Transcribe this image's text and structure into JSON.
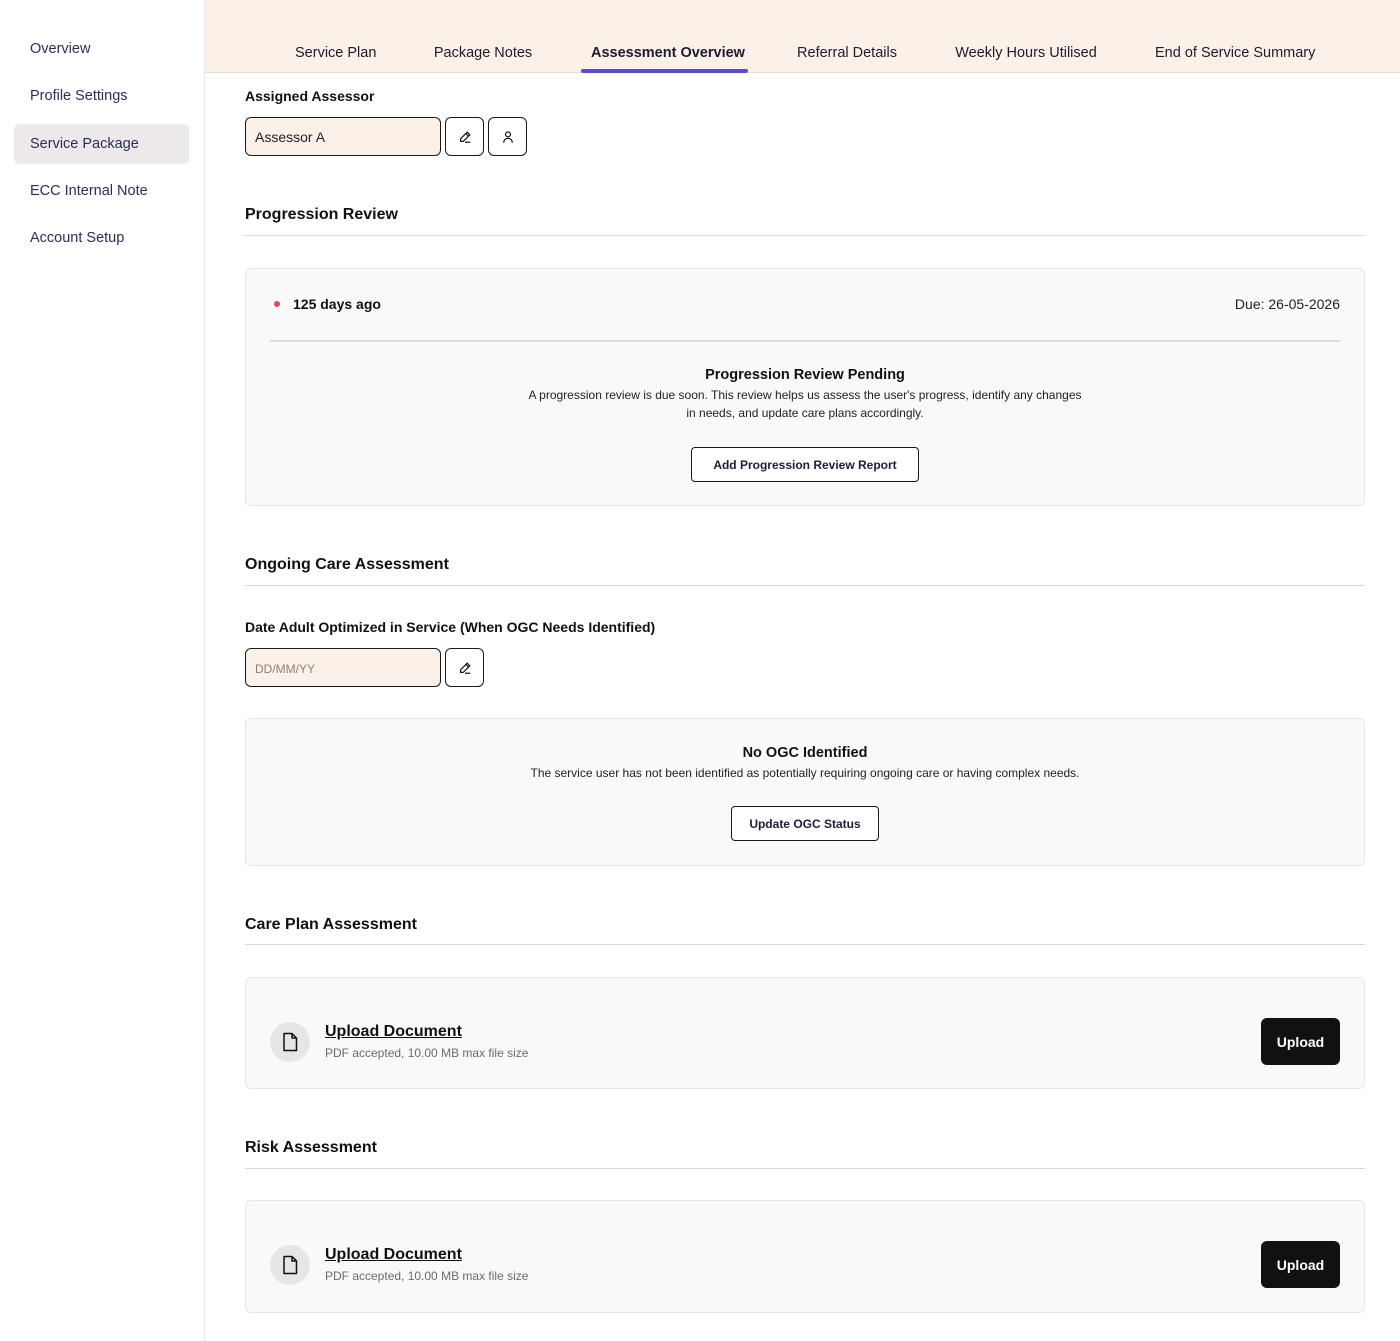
{
  "sidebar": {
    "items": [
      {
        "label": "Overview",
        "active": false
      },
      {
        "label": "Profile Settings",
        "active": false
      },
      {
        "label": "Service Package",
        "active": true
      },
      {
        "label": "ECC Internal Note",
        "active": false
      },
      {
        "label": "Account Setup",
        "active": false
      }
    ]
  },
  "tabs": [
    {
      "label": "Service Plan",
      "active": false
    },
    {
      "label": "Package Notes",
      "active": false
    },
    {
      "label": "Assessment Overview",
      "active": true
    },
    {
      "label": "Referral Details",
      "active": false
    },
    {
      "label": "Weekly Hours Utilised",
      "active": false
    },
    {
      "label": "End of Service Summary",
      "active": false
    }
  ],
  "assessor": {
    "label": "Assigned Assessor",
    "value": "Assessor A",
    "edit_icon": "pencil-icon",
    "person_icon": "user-icon"
  },
  "progression": {
    "title": "Progression Review",
    "status_text": "125 days ago",
    "status_color": "#e5484d",
    "due": "Due: 26-05-2026",
    "pending_title": "Progression Review Pending",
    "pending_desc_1": "A progression review is due soon. This review helps us assess the user's progress, identify any changes",
    "pending_desc_2": "in needs, and update care plans accordingly.",
    "button": "Add Progression Review Report"
  },
  "ogc": {
    "title": "Ongoing Care Assessment",
    "date_label": "Date Adult Optimized in Service (When OGC Needs Identified)",
    "date_placeholder": "DD/MM/YY",
    "none_title": "No OGC Identified",
    "none_desc": "The service user has not been identified as potentially requiring ongoing care or having complex needs.",
    "button": "Update OGC Status"
  },
  "care_plan": {
    "title": "Care Plan Assessment",
    "link": "Upload Document",
    "sub": "PDF accepted, 10.00 MB max file size",
    "button": "Upload"
  },
  "risk": {
    "title": "Risk Assessment",
    "link": "Upload Document",
    "sub": "PDF accepted, 10.00 MB max file size",
    "button": "Upload"
  },
  "colors": {
    "accent": "#5a4bd6",
    "tab_bar_bg": "#fbf1e8",
    "sidebar_active_bg": "#ede8ea"
  }
}
